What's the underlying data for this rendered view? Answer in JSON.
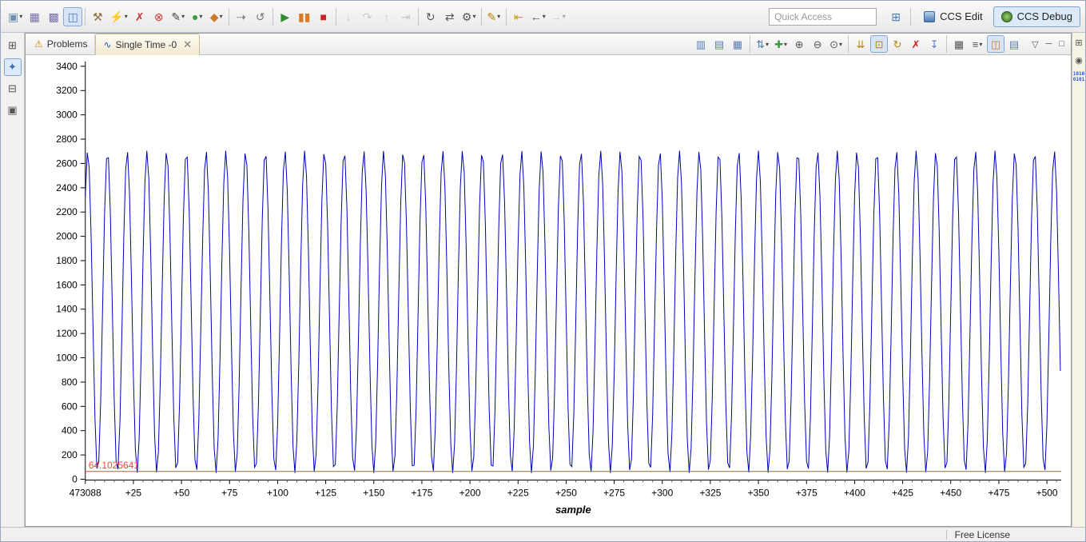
{
  "toolbar": {
    "quick_access_placeholder": "Quick Access",
    "perspectives": [
      {
        "label": "CCS Edit",
        "active": false
      },
      {
        "label": "CCS Debug",
        "active": true
      }
    ],
    "icons": [
      {
        "name": "new-wizard-icon",
        "glyph": "▣",
        "color": "#6b8fbf",
        "dropdown": true
      },
      {
        "name": "save-icon",
        "glyph": "▦",
        "color": "#7b6fae"
      },
      {
        "name": "save-all-icon",
        "glyph": "▩",
        "color": "#7b6fae"
      },
      {
        "name": "target-config-icon",
        "glyph": "◫",
        "color": "#4a7ab5",
        "highlighted": true
      },
      {
        "sep": true
      },
      {
        "name": "build-icon",
        "glyph": "⚒",
        "color": "#8a6d3b"
      },
      {
        "name": "flash-icon",
        "glyph": "⚡",
        "color": "#b8860b",
        "dropdown": true
      },
      {
        "name": "cancel-build-icon",
        "glyph": "✗",
        "color": "#cc3333"
      },
      {
        "name": "terminate-all-icon",
        "glyph": "⊗",
        "color": "#cc3333"
      },
      {
        "name": "pen-icon",
        "glyph": "✎",
        "color": "#444",
        "dropdown": true
      },
      {
        "name": "run-icon",
        "glyph": "●",
        "color": "#3a9b3a",
        "dropdown": true
      },
      {
        "name": "profile-icon",
        "glyph": "◆",
        "color": "#cc7a29",
        "dropdown": true
      },
      {
        "sep": true
      },
      {
        "name": "skip-breakpoints-icon",
        "glyph": "⇢",
        "color": "#777"
      },
      {
        "name": "reset-target-icon",
        "glyph": "↺",
        "color": "#777"
      },
      {
        "sep": true
      },
      {
        "name": "resume-icon",
        "glyph": "▶",
        "color": "#2e8b2e"
      },
      {
        "name": "suspend-icon",
        "glyph": "▮▮",
        "color": "#e07820"
      },
      {
        "name": "terminate-icon",
        "glyph": "■",
        "color": "#cc2222"
      },
      {
        "sep": true
      },
      {
        "name": "step-into-icon",
        "glyph": "↓",
        "color": "#999",
        "disabled": true
      },
      {
        "name": "step-over-icon",
        "glyph": "↷",
        "color": "#999",
        "disabled": true
      },
      {
        "name": "step-return-icon",
        "glyph": "↑",
        "color": "#999",
        "disabled": true
      },
      {
        "name": "instruction-step-icon",
        "glyph": "⇥",
        "color": "#999",
        "disabled": true
      },
      {
        "sep": true
      },
      {
        "name": "restart-icon",
        "glyph": "↻",
        "color": "#555"
      },
      {
        "name": "refresh-icon",
        "glyph": "⇄",
        "color": "#555"
      },
      {
        "name": "settings-icon",
        "glyph": "⚙",
        "color": "#555",
        "dropdown": true
      },
      {
        "sep": true
      },
      {
        "name": "trace-icon",
        "glyph": "✎",
        "color": "#b8860b",
        "dropdown": true
      },
      {
        "sep": true
      },
      {
        "name": "last-edit-icon",
        "glyph": "⇤",
        "color": "#c8a400"
      },
      {
        "name": "back-icon",
        "glyph": "←",
        "color": "#555",
        "dropdown": true
      },
      {
        "name": "forward-icon",
        "glyph": "→",
        "color": "#999",
        "dropdown": true,
        "disabled": true
      }
    ]
  },
  "left_strip": {
    "icons": [
      {
        "name": "restore-editor-icon",
        "glyph": "⊞",
        "color": "#555"
      },
      {
        "name": "debug-perspective-icon",
        "glyph": "✦",
        "color": "#3a6fb5",
        "highlighted": true
      },
      {
        "name": "restore-view-icon",
        "glyph": "⊟",
        "color": "#555"
      },
      {
        "name": "console-view-icon",
        "glyph": "▣",
        "color": "#555"
      }
    ]
  },
  "right_strip": {
    "icons": [
      {
        "name": "restore-panel-icon",
        "glyph": "⊞",
        "color": "#555"
      },
      {
        "name": "expressions-view-icon",
        "glyph": "◉",
        "color": "#555"
      }
    ],
    "memory_browser": {
      "line1": "1010",
      "line2": "0101"
    }
  },
  "tabs": [
    {
      "label": "Problems",
      "icon_glyph": "⚠",
      "icon_color": "#cc8800",
      "active": false
    },
    {
      "label": "Single Time -0",
      "icon_glyph": "∿",
      "icon_color": "#2255cc",
      "active": true,
      "close_glyph": "✕"
    }
  ],
  "graph_toolbar": {
    "icons": [
      {
        "name": "combine-graphs-icon",
        "glyph": "▥",
        "color": "#5b7fb5"
      },
      {
        "name": "float-view-icon",
        "glyph": "▤",
        "color": "#5b7fb5"
      },
      {
        "name": "dock-view-icon",
        "glyph": "▦",
        "color": "#5b7fb5"
      },
      {
        "sep": true
      },
      {
        "name": "sort-icon",
        "glyph": "⇅",
        "color": "#4a7ab5",
        "dropdown": true
      },
      {
        "name": "add-graph-icon",
        "glyph": "✚",
        "color": "#3a9b3a",
        "dropdown": true
      },
      {
        "name": "zoom-in-icon",
        "glyph": "⊕",
        "color": "#555"
      },
      {
        "name": "zoom-out-icon",
        "glyph": "⊖",
        "color": "#555"
      },
      {
        "name": "search-icon",
        "glyph": "⊙",
        "color": "#555",
        "dropdown": true
      },
      {
        "sep": true
      },
      {
        "name": "scroll-lock-icon",
        "glyph": "⇊",
        "color": "#b8860b"
      },
      {
        "name": "auto-scale-icon",
        "glyph": "⊡",
        "color": "#b8860b",
        "highlighted": true
      },
      {
        "name": "reset-view-icon",
        "glyph": "↻",
        "color": "#b8860b"
      },
      {
        "name": "clear-graph-icon",
        "glyph": "✗",
        "color": "#cc2222"
      },
      {
        "name": "export-data-icon",
        "glyph": "↧",
        "color": "#5b7fb5"
      },
      {
        "sep": true
      },
      {
        "name": "grid-icon",
        "glyph": "▦",
        "color": "#555"
      },
      {
        "name": "legend-icon",
        "glyph": "≡",
        "color": "#555",
        "dropdown": true
      },
      {
        "name": "measure-icon",
        "glyph": "◫",
        "color": "#e07820",
        "highlighted": true
      },
      {
        "name": "properties-icon",
        "glyph": "▤",
        "color": "#5b7fb5"
      }
    ]
  },
  "view_controls": [
    {
      "name": "view-menu-icon",
      "glyph": "▽"
    },
    {
      "name": "minimize-icon",
      "glyph": "─"
    },
    {
      "name": "maximize-icon",
      "glyph": "□"
    }
  ],
  "status_bar": {
    "license": "Free License"
  },
  "chart_data": {
    "type": "line",
    "title": "Single Time -0",
    "xlabel": "sample",
    "x_start": 473088,
    "x_tick_step": 25,
    "x_ticks": [
      "473088",
      "+25",
      "+50",
      "+75",
      "+100",
      "+125",
      "+150",
      "+175",
      "+200",
      "+225",
      "+250",
      "+275",
      "+300",
      "+325",
      "+350",
      "+375",
      "+400",
      "+425",
      "+450",
      "+475",
      "+500"
    ],
    "visible_samples": 507,
    "ylim": [
      0,
      3400
    ],
    "y_tick_step": 200,
    "grid": false,
    "legend": false,
    "line_color": "#0000bb",
    "cursor_color": "#ff4433",
    "cursor_value": 64.1025641,
    "cursor_label": "64.1025641",
    "waveform": {
      "shape": "sine",
      "offset": 1378,
      "amplitude": 1327,
      "period_samples": 10.2564,
      "phase": 0.8,
      "approx_min": 51,
      "approx_max": 2705
    }
  }
}
